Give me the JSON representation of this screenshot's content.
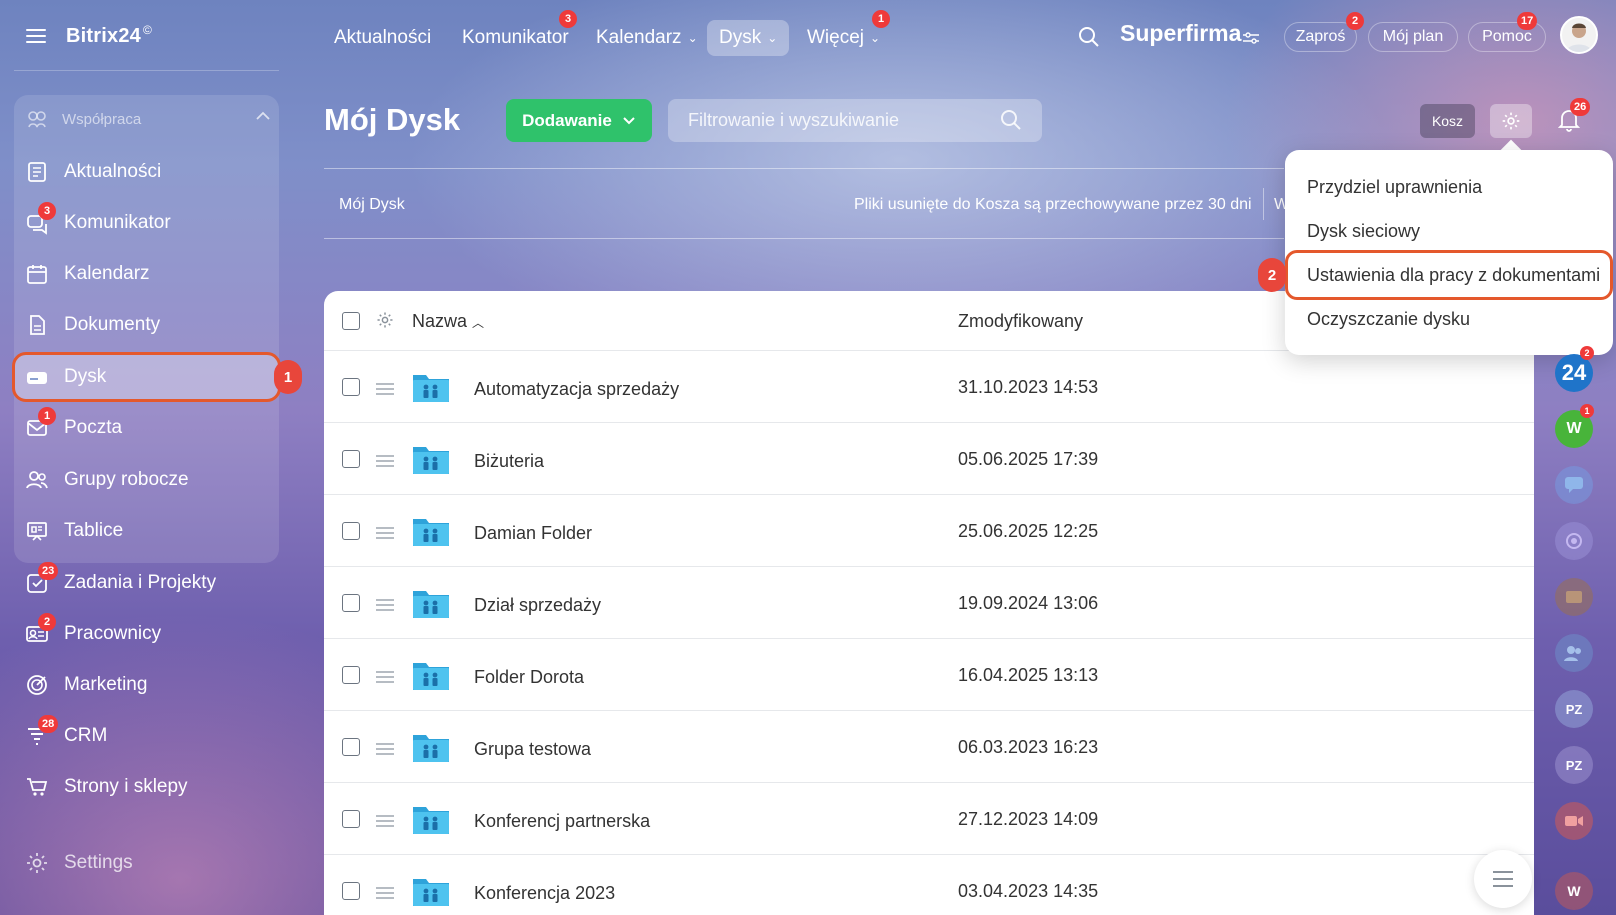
{
  "app": {
    "logo": "Bitrix24",
    "logo_mark": "©"
  },
  "topnav": {
    "items": [
      {
        "label": "Aktualności"
      },
      {
        "label": "Komunikator",
        "badge": "3"
      },
      {
        "label": "Kalendarz"
      },
      {
        "label": "Dysk"
      },
      {
        "label": "Więcej",
        "badge": "1"
      }
    ],
    "company": "Superfirma",
    "invite": {
      "label": "Zaproś",
      "badge": "2"
    },
    "plan": "Mój plan",
    "help": {
      "label": "Pomoc",
      "badge": "17"
    }
  },
  "sidebar": {
    "group_title": "Współpraca",
    "items": [
      {
        "label": "Aktualności"
      },
      {
        "label": "Komunikator",
        "badge": "3"
      },
      {
        "label": "Kalendarz"
      },
      {
        "label": "Dokumenty"
      },
      {
        "label": "Dysk"
      },
      {
        "label": "Poczta",
        "badge": "1"
      },
      {
        "label": "Grupy robocze"
      },
      {
        "label": "Tablice"
      },
      {
        "label": "Zadania i Projekty",
        "badge": "23"
      },
      {
        "label": "Pracownicy",
        "badge": "2"
      },
      {
        "label": "Marketing"
      },
      {
        "label": "CRM",
        "badge": "28"
      },
      {
        "label": "Strony i sklepy"
      },
      {
        "label": "Settings"
      }
    ]
  },
  "callouts": {
    "first": "1",
    "second": "2"
  },
  "page": {
    "title": "Mój Dysk",
    "add_button": "Dodawanie",
    "search_placeholder": "Filtrowanie i wyszukiwanie",
    "trash_button": "Kosz",
    "notifications_badge": "26",
    "breadcrumb": "Mój Dysk",
    "trash_info": "Pliki usunięte do Kosza są przechowywane przez 30 dni",
    "trash_info_cut": "W"
  },
  "table": {
    "columns": {
      "name": "Nazwa",
      "modified": "Zmodyfikowany"
    },
    "rows": [
      {
        "name": "Automatyzacja sprzedaży",
        "modified": "31.10.2023 14:53"
      },
      {
        "name": "Biżuteria",
        "modified": "05.06.2025 17:39"
      },
      {
        "name": "Damian Folder",
        "modified": "25.06.2025 12:25"
      },
      {
        "name": "Dział sprzedaży",
        "modified": "19.09.2024 13:06"
      },
      {
        "name": "Folder Dorota",
        "modified": "16.04.2025 13:13"
      },
      {
        "name": "Grupa testowa",
        "modified": "06.03.2023 16:23"
      },
      {
        "name": "Konferencj partnerska",
        "modified": "27.12.2023 14:09"
      },
      {
        "name": "Konferencja 2023",
        "modified": "03.04.2023 14:35"
      }
    ]
  },
  "menu": {
    "items": [
      {
        "label": "Przydziel uprawnienia"
      },
      {
        "label": "Dysk sieciowy"
      },
      {
        "label": "Ustawienia dla pracy z dokumentami"
      },
      {
        "label": "Oczyszczanie dysku"
      }
    ]
  },
  "rail": {
    "b24": "24",
    "b24_badge": "2",
    "w_label": "W",
    "w_badge": "1",
    "pz1": "PZ",
    "pz2": "PZ",
    "w2": "W"
  },
  "colors": {
    "accent_green": "#2fc26b",
    "badge_red": "#ef3a3a",
    "highlight": "#e4582c",
    "folder": "#3fb8ea"
  }
}
